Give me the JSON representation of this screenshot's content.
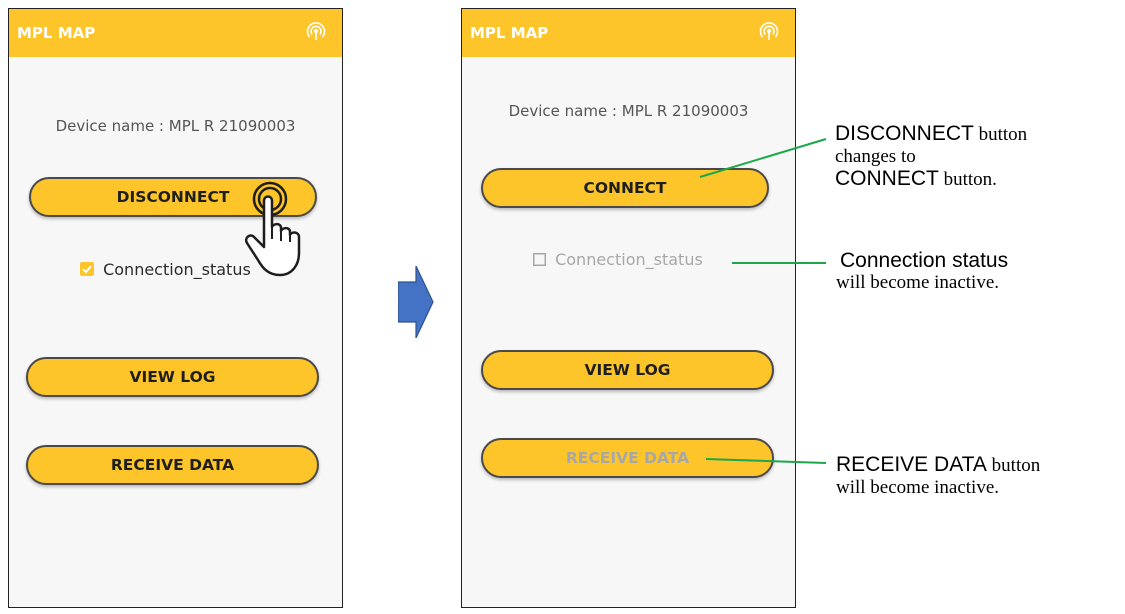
{
  "before": {
    "app_title": "MPL MAP",
    "device_name": "Device name : MPL R 21090003",
    "primary_button": "DISCONNECT",
    "status_label": "Connection_status",
    "status_checked": true,
    "view_log": "VIEW LOG",
    "receive_data": "RECEIVE DATA"
  },
  "after": {
    "app_title": "MPL MAP",
    "device_name": "Device name : MPL R 21090003",
    "primary_button": "CONNECT",
    "status_label": "Connection_status",
    "status_checked": false,
    "view_log": "VIEW LOG",
    "receive_data": "RECEIVE DATA"
  },
  "annotations": {
    "a1": {
      "big": "DISCONNECT",
      "l1_tail": " button",
      "l2": "changes to",
      "big2": "CONNECT",
      "l3_tail": " button."
    },
    "a2": {
      "big": "Connection status",
      "l2": "will become inactive."
    },
    "a3": {
      "big": "RECEIVE DATA",
      "l1_tail": " button",
      "l2": "will become inactive."
    }
  },
  "colors": {
    "accent": "#fdc52a",
    "arrow": "#4472c4",
    "callout_line": "#1aa84a",
    "checkbox_checked": "#fdc52a",
    "inactive_text": "#a7a7a7"
  },
  "icons": [
    "antenna-signal-icon",
    "tap-hand-icon",
    "right-arrow-icon",
    "checkbox-icon"
  ]
}
